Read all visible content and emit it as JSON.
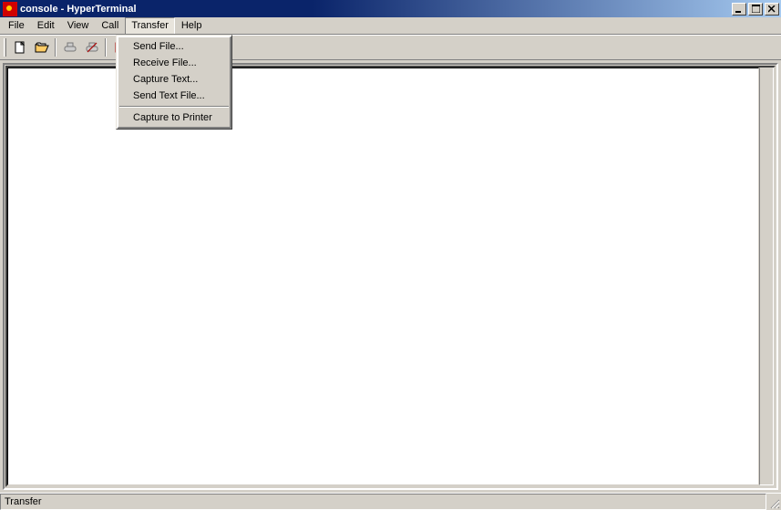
{
  "title": "console - HyperTerminal",
  "menubar": {
    "items": [
      {
        "label": "File"
      },
      {
        "label": "Edit"
      },
      {
        "label": "View"
      },
      {
        "label": "Call"
      },
      {
        "label": "Transfer"
      },
      {
        "label": "Help"
      }
    ],
    "active_index": 4
  },
  "toolbar": {
    "buttons": [
      {
        "icon": "new-icon"
      },
      {
        "icon": "open-icon"
      },
      {
        "sep": true
      },
      {
        "icon": "connect-icon"
      },
      {
        "icon": "disconnect-icon"
      },
      {
        "sep": true
      },
      {
        "icon": "send-icon"
      },
      {
        "icon": "properties-icon"
      }
    ]
  },
  "dropdown": {
    "items": [
      {
        "label": "Send File..."
      },
      {
        "label": "Receive File..."
      },
      {
        "label": "Capture Text..."
      },
      {
        "label": "Send Text File..."
      },
      {
        "sep": true
      },
      {
        "label": "Capture to Printer"
      }
    ]
  },
  "statusbar": {
    "text": "Transfer"
  },
  "terminal": {
    "content": ""
  }
}
